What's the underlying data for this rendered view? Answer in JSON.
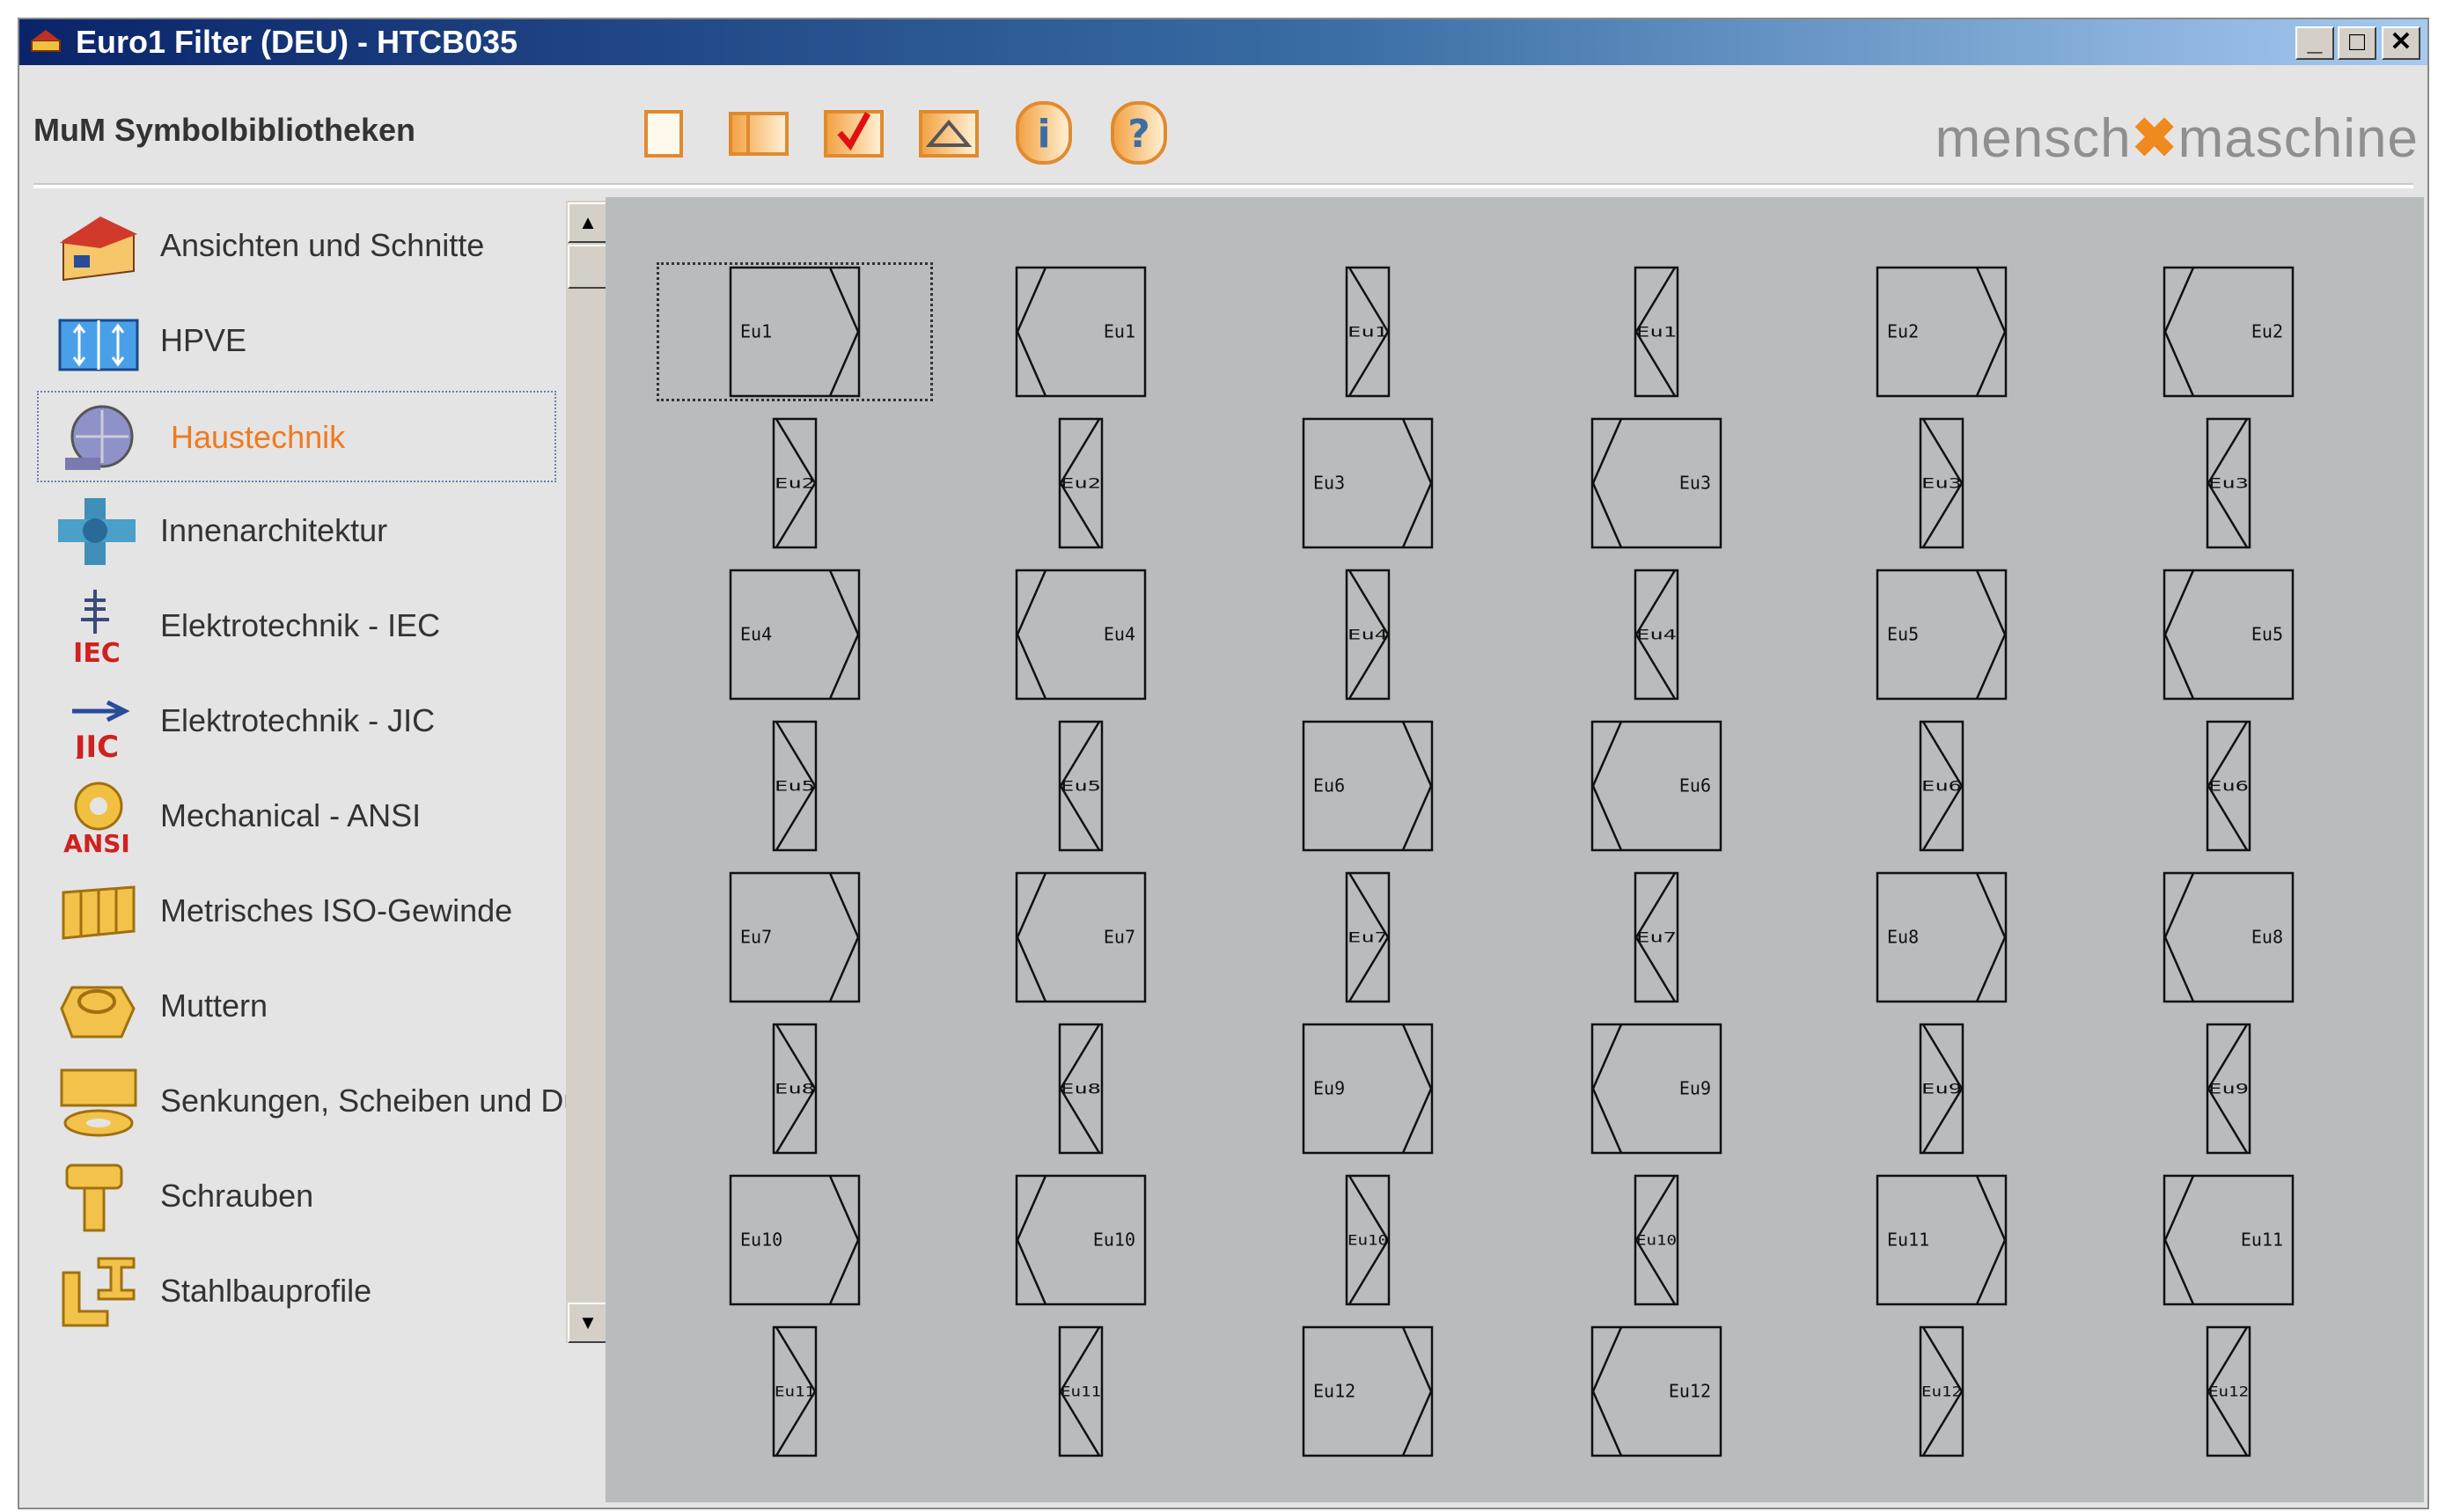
{
  "window": {
    "title": "Euro1 Filter (DEU) - HTCB035",
    "controls": {
      "minimize": "_",
      "maximize": "□",
      "close": "✕"
    }
  },
  "header": {
    "label": "MuM Symbolbibliotheken",
    "logo_left": "mensch",
    "logo_mark": "✖",
    "logo_right": "maschine",
    "toolbar": [
      {
        "icon": "blank-page-icon"
      },
      {
        "icon": "two-pane-icon"
      },
      {
        "icon": "check-icon"
      },
      {
        "icon": "shape-edit-icon"
      },
      {
        "icon": "info-icon",
        "glyph": "i"
      },
      {
        "icon": "help-icon",
        "glyph": "?"
      }
    ]
  },
  "sidebar": {
    "items": [
      {
        "label": "Ansichten und Schnitte",
        "icon": "house-icon"
      },
      {
        "label": "HPVE",
        "icon": "hpve-icon"
      },
      {
        "label": "Haustechnik",
        "icon": "hvac-fan-icon",
        "selected": true
      },
      {
        "label": "Innenarchitektur",
        "icon": "interior-icon"
      },
      {
        "label": "Elektrotechnik - IEC",
        "icon": "iec-icon",
        "badge": "IEC"
      },
      {
        "label": "Elektrotechnik - JIC",
        "icon": "jic-icon",
        "badge": "JIC"
      },
      {
        "label": "Mechanical - ANSI",
        "icon": "ansi-gear-icon",
        "badge": "ANSI"
      },
      {
        "label": "Metrisches ISO-Gewinde",
        "icon": "thread-icon"
      },
      {
        "label": "Muttern",
        "icon": "nut-icon"
      },
      {
        "label": "Senkungen, Scheiben und Du",
        "icon": "washer-icon"
      },
      {
        "label": "Schrauben",
        "icon": "screw-icon"
      },
      {
        "label": "Stahlbauprofile",
        "icon": "steel-profile-icon"
      }
    ],
    "scroll_up": "▲",
    "scroll_down": "▼"
  },
  "symbols": [
    [
      "Eu1",
      "Eu1",
      "Eu1",
      "Eu1",
      "Eu2",
      "Eu2"
    ],
    [
      "Eu2",
      "Eu2",
      "Eu3",
      "Eu3",
      "Eu3",
      "Eu3"
    ],
    [
      "Eu4",
      "Eu4",
      "Eu4",
      "Eu4",
      "Eu5",
      "Eu5"
    ],
    [
      "Eu5",
      "Eu5",
      "Eu6",
      "Eu6",
      "Eu6",
      "Eu6"
    ],
    [
      "Eu7",
      "Eu7",
      "Eu7",
      "Eu7",
      "Eu8",
      "Eu8"
    ],
    [
      "Eu8",
      "Eu8",
      "Eu9",
      "Eu9",
      "Eu9",
      "Eu9"
    ],
    [
      "Eu10",
      "Eu10",
      "Eu10",
      "Eu10",
      "Eu11",
      "Eu11"
    ],
    [
      "Eu11",
      "Eu11",
      "Eu12",
      "Eu12",
      "Eu12",
      "Eu12"
    ]
  ]
}
